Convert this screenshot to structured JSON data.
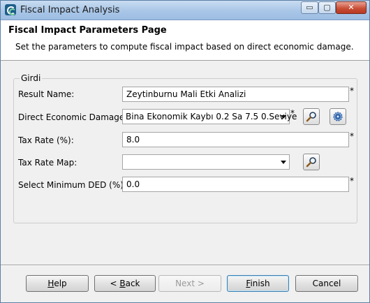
{
  "window": {
    "title": "Fiscal Impact Analysis",
    "controls": {
      "minimize": "▭",
      "maximize": "▢",
      "close": "✕"
    }
  },
  "header": {
    "title": "Fiscal Impact Parameters Page",
    "description": "Set the parameters to compute fiscal impact based on direct economic damage."
  },
  "group": {
    "label": "Girdi",
    "rows": {
      "result_name": {
        "label": "Result Name:",
        "value": "Zeytinburnu Mali Etki Analizi",
        "required": "*"
      },
      "direct_damage": {
        "label": "Direct Economic Damage:",
        "value": "Bina Ekonomik Kaybı 0.2 Sa 7.5 0.Seviye",
        "required": "*"
      },
      "tax_rate": {
        "label": "Tax Rate (%):",
        "value": "8.0",
        "required": "*"
      },
      "tax_rate_map": {
        "label": "Tax Rate Map:",
        "value": ""
      },
      "min_ded": {
        "label": "Select Minimum DED (%):",
        "value": "0.0",
        "required": "*"
      }
    }
  },
  "buttons": {
    "help": {
      "mnemonic": "H",
      "rest": "elp"
    },
    "back_prefix": "< ",
    "back": {
      "mnemonic": "B",
      "rest": "ack"
    },
    "next": "Next >",
    "finish": {
      "mnemonic": "F",
      "rest": "inish"
    },
    "cancel": "Cancel"
  },
  "icons": {
    "search": "magnifier-icon",
    "configure": "gear-icon"
  }
}
